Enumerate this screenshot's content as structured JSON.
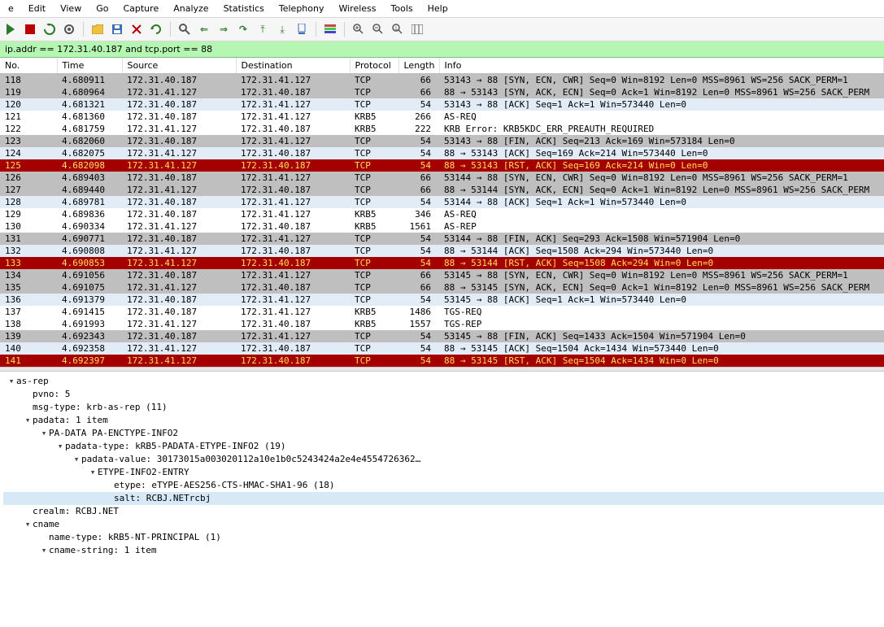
{
  "menu": [
    "e",
    "Edit",
    "View",
    "Go",
    "Capture",
    "Analyze",
    "Statistics",
    "Telephony",
    "Wireless",
    "Tools",
    "Help"
  ],
  "filter": {
    "value": "ip.addr == 172.31.40.187 and tcp.port == 88"
  },
  "columns": [
    "No.",
    "Time",
    "Source",
    "Destination",
    "Protocol",
    "Length",
    "Info"
  ],
  "packets": [
    {
      "no": "118",
      "time": "4.680911",
      "src": "172.31.40.187",
      "dst": "172.31.41.127",
      "prot": "TCP",
      "len": "66",
      "info": "53143 → 88 [SYN, ECN, CWR] Seq=0 Win=8192 Len=0 MSS=8961 WS=256 SACK_PERM=1",
      "style": "gray"
    },
    {
      "no": "119",
      "time": "4.680964",
      "src": "172.31.41.127",
      "dst": "172.31.40.187",
      "prot": "TCP",
      "len": "66",
      "info": "88 → 53143 [SYN, ACK, ECN] Seq=0 Ack=1 Win=8192 Len=0 MSS=8961 WS=256 SACK_PERM",
      "style": "gray"
    },
    {
      "no": "120",
      "time": "4.681321",
      "src": "172.31.40.187",
      "dst": "172.31.41.127",
      "prot": "TCP",
      "len": "54",
      "info": "53143 → 88 [ACK] Seq=1 Ack=1 Win=573440 Len=0",
      "style": "lightblue"
    },
    {
      "no": "121",
      "time": "4.681360",
      "src": "172.31.40.187",
      "dst": "172.31.41.127",
      "prot": "KRB5",
      "len": "266",
      "info": "AS-REQ",
      "style": "default"
    },
    {
      "no": "122",
      "time": "4.681759",
      "src": "172.31.41.127",
      "dst": "172.31.40.187",
      "prot": "KRB5",
      "len": "222",
      "info": "KRB Error: KRB5KDC_ERR_PREAUTH_REQUIRED",
      "style": "default"
    },
    {
      "no": "123",
      "time": "4.682060",
      "src": "172.31.40.187",
      "dst": "172.31.41.127",
      "prot": "TCP",
      "len": "54",
      "info": "53143 → 88 [FIN, ACK] Seq=213 Ack=169 Win=573184 Len=0",
      "style": "gray"
    },
    {
      "no": "124",
      "time": "4.682075",
      "src": "172.31.41.127",
      "dst": "172.31.40.187",
      "prot": "TCP",
      "len": "54",
      "info": "88 → 53143 [ACK] Seq=169 Ack=214 Win=573440 Len=0",
      "style": "lightblue"
    },
    {
      "no": "125",
      "time": "4.682098",
      "src": "172.31.41.127",
      "dst": "172.31.40.187",
      "prot": "TCP",
      "len": "54",
      "info": "88 → 53143 [RST, ACK] Seq=169 Ack=214 Win=0 Len=0",
      "style": "red"
    },
    {
      "no": "126",
      "time": "4.689403",
      "src": "172.31.40.187",
      "dst": "172.31.41.127",
      "prot": "TCP",
      "len": "66",
      "info": "53144 → 88 [SYN, ECN, CWR] Seq=0 Win=8192 Len=0 MSS=8961 WS=256 SACK_PERM=1",
      "style": "gray"
    },
    {
      "no": "127",
      "time": "4.689440",
      "src": "172.31.41.127",
      "dst": "172.31.40.187",
      "prot": "TCP",
      "len": "66",
      "info": "88 → 53144 [SYN, ACK, ECN] Seq=0 Ack=1 Win=8192 Len=0 MSS=8961 WS=256 SACK_PERM",
      "style": "gray"
    },
    {
      "no": "128",
      "time": "4.689781",
      "src": "172.31.40.187",
      "dst": "172.31.41.127",
      "prot": "TCP",
      "len": "54",
      "info": "53144 → 88 [ACK] Seq=1 Ack=1 Win=573440 Len=0",
      "style": "lightblue"
    },
    {
      "no": "129",
      "time": "4.689836",
      "src": "172.31.40.187",
      "dst": "172.31.41.127",
      "prot": "KRB5",
      "len": "346",
      "info": "AS-REQ",
      "style": "default"
    },
    {
      "no": "130",
      "time": "4.690334",
      "src": "172.31.41.127",
      "dst": "172.31.40.187",
      "prot": "KRB5",
      "len": "1561",
      "info": "AS-REP",
      "style": "default"
    },
    {
      "no": "131",
      "time": "4.690771",
      "src": "172.31.40.187",
      "dst": "172.31.41.127",
      "prot": "TCP",
      "len": "54",
      "info": "53144 → 88 [FIN, ACK] Seq=293 Ack=1508 Win=571904 Len=0",
      "style": "gray"
    },
    {
      "no": "132",
      "time": "4.690808",
      "src": "172.31.41.127",
      "dst": "172.31.40.187",
      "prot": "TCP",
      "len": "54",
      "info": "88 → 53144 [ACK] Seq=1508 Ack=294 Win=573440 Len=0",
      "style": "lightblue"
    },
    {
      "no": "133",
      "time": "4.690853",
      "src": "172.31.41.127",
      "dst": "172.31.40.187",
      "prot": "TCP",
      "len": "54",
      "info": "88 → 53144 [RST, ACK] Seq=1508 Ack=294 Win=0 Len=0",
      "style": "red"
    },
    {
      "no": "134",
      "time": "4.691056",
      "src": "172.31.40.187",
      "dst": "172.31.41.127",
      "prot": "TCP",
      "len": "66",
      "info": "53145 → 88 [SYN, ECN, CWR] Seq=0 Win=8192 Len=0 MSS=8961 WS=256 SACK_PERM=1",
      "style": "gray"
    },
    {
      "no": "135",
      "time": "4.691075",
      "src": "172.31.41.127",
      "dst": "172.31.40.187",
      "prot": "TCP",
      "len": "66",
      "info": "88 → 53145 [SYN, ACK, ECN] Seq=0 Ack=1 Win=8192 Len=0 MSS=8961 WS=256 SACK_PERM",
      "style": "gray"
    },
    {
      "no": "136",
      "time": "4.691379",
      "src": "172.31.40.187",
      "dst": "172.31.41.127",
      "prot": "TCP",
      "len": "54",
      "info": "53145 → 88 [ACK] Seq=1 Ack=1 Win=573440 Len=0",
      "style": "lightblue"
    },
    {
      "no": "137",
      "time": "4.691415",
      "src": "172.31.40.187",
      "dst": "172.31.41.127",
      "prot": "KRB5",
      "len": "1486",
      "info": "TGS-REQ",
      "style": "default"
    },
    {
      "no": "138",
      "time": "4.691993",
      "src": "172.31.41.127",
      "dst": "172.31.40.187",
      "prot": "KRB5",
      "len": "1557",
      "info": "TGS-REP",
      "style": "default"
    },
    {
      "no": "139",
      "time": "4.692343",
      "src": "172.31.40.187",
      "dst": "172.31.41.127",
      "prot": "TCP",
      "len": "54",
      "info": "53145 → 88 [FIN, ACK] Seq=1433 Ack=1504 Win=571904 Len=0",
      "style": "gray"
    },
    {
      "no": "140",
      "time": "4.692358",
      "src": "172.31.41.127",
      "dst": "172.31.40.187",
      "prot": "TCP",
      "len": "54",
      "info": "88 → 53145 [ACK] Seq=1504 Ack=1434 Win=573440 Len=0",
      "style": "lightblue"
    },
    {
      "no": "141",
      "time": "4.692397",
      "src": "172.31.41.127",
      "dst": "172.31.40.187",
      "prot": "TCP",
      "len": "54",
      "info": "88 → 53145 [RST, ACK] Seq=1504 Ack=1434 Win=0 Len=0",
      "style": "red"
    }
  ],
  "tree": [
    {
      "depth": 0,
      "tw": "v",
      "text": "as-rep",
      "name": "tree-as-rep",
      "inter": true
    },
    {
      "depth": 1,
      "tw": "",
      "text": "pvno: 5",
      "name": "tree-pvno",
      "inter": true
    },
    {
      "depth": 1,
      "tw": "",
      "text": "msg-type: krb-as-rep (11)",
      "name": "tree-msg-type",
      "inter": true
    },
    {
      "depth": 1,
      "tw": "v",
      "text": "padata: 1 item",
      "name": "tree-padata",
      "inter": true
    },
    {
      "depth": 2,
      "tw": "v",
      "text": "PA-DATA PA-ENCTYPE-INFO2",
      "name": "tree-pa-data",
      "inter": true
    },
    {
      "depth": 3,
      "tw": "v",
      "text": "padata-type: kRB5-PADATA-ETYPE-INFO2 (19)",
      "name": "tree-padata-type",
      "inter": true
    },
    {
      "depth": 4,
      "tw": "v",
      "text": "padata-value: 30173015a003020112a10e1b0c5243424a2e4e4554726362…",
      "name": "tree-padata-value",
      "inter": true
    },
    {
      "depth": 5,
      "tw": "v",
      "text": "ETYPE-INFO2-ENTRY",
      "name": "tree-etype-info2-entry",
      "inter": true
    },
    {
      "depth": 6,
      "tw": "",
      "text": "etype: eTYPE-AES256-CTS-HMAC-SHA1-96 (18)",
      "name": "tree-etype",
      "inter": true
    },
    {
      "depth": 6,
      "tw": "",
      "text": "salt: RCBJ.NETrcbj",
      "name": "tree-salt",
      "inter": true,
      "hl": true
    },
    {
      "depth": 1,
      "tw": "",
      "text": "crealm: RCBJ.NET",
      "name": "tree-crealm",
      "inter": true
    },
    {
      "depth": 1,
      "tw": "v",
      "text": "cname",
      "name": "tree-cname",
      "inter": true
    },
    {
      "depth": 2,
      "tw": "",
      "text": "name-type: kRB5-NT-PRINCIPAL (1)",
      "name": "tree-name-type",
      "inter": true
    },
    {
      "depth": 2,
      "tw": "v",
      "text": "cname-string: 1 item",
      "name": "tree-cname-string",
      "inter": true
    }
  ]
}
